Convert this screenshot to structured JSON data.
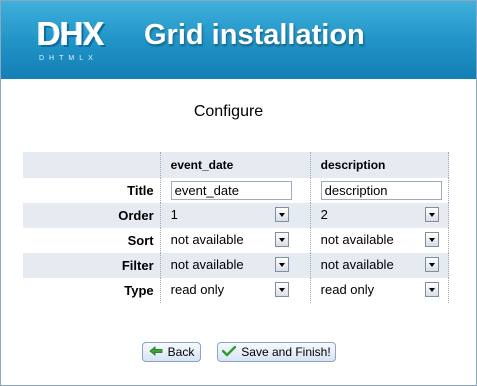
{
  "app": {
    "logo_mark": "DHX",
    "logo_sub": "DHTMLX",
    "title": "Grid installation"
  },
  "section_title": "Configure",
  "columns": [
    {
      "header": "event_date",
      "title_value": "event_date",
      "order": "1",
      "sort": "not available",
      "filter": "not available",
      "type": "read only"
    },
    {
      "header": "description",
      "title_value": "description",
      "order": "2",
      "sort": "not available",
      "filter": "not available",
      "type": "read only"
    }
  ],
  "row_labels": {
    "title": "Title",
    "order": "Order",
    "sort": "Sort",
    "filter": "Filter",
    "type": "Type"
  },
  "buttons": {
    "back": "Back",
    "finish": "Save and Finish!"
  },
  "icons": {
    "back": "back-arrow-icon",
    "finish": "checkmark-icon",
    "dropdown": "chevron-down-icon"
  }
}
